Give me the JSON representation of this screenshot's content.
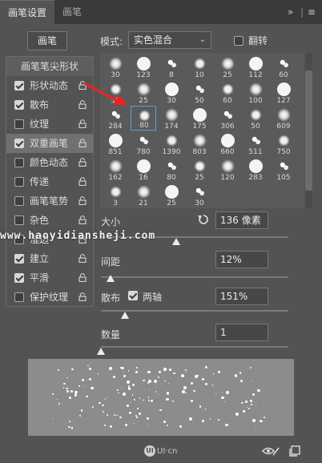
{
  "tabs": [
    {
      "label": "画笔设置",
      "active": true
    },
    {
      "label": "画笔",
      "active": false
    }
  ],
  "toolbar": {
    "expand_icon": "double-chevron-right-icon",
    "menu_icon": "menu-icon"
  },
  "brush_button_label": "画笔",
  "mode": {
    "label": "模式:",
    "value": "实色混合"
  },
  "flip": {
    "label": "翻转",
    "checked": false
  },
  "side_items": [
    {
      "label": "画笔笔尖形状",
      "head": true
    },
    {
      "label": "形状动态",
      "checked": true,
      "lock": true
    },
    {
      "label": "散布",
      "checked": true,
      "lock": true
    },
    {
      "label": "纹理",
      "checked": false,
      "lock": true
    },
    {
      "label": "双重画笔",
      "checked": true,
      "lock": true,
      "selected": true
    },
    {
      "label": "颜色动态",
      "checked": false,
      "lock": true
    },
    {
      "label": "传递",
      "checked": false,
      "lock": true
    },
    {
      "label": "画笔笔势",
      "checked": false,
      "lock": true
    },
    {
      "label": "杂色",
      "checked": false,
      "lock": true
    },
    {
      "label": "湿边",
      "checked": false,
      "lock": true
    },
    {
      "label": "建立",
      "checked": true,
      "lock": true
    },
    {
      "label": "平滑",
      "checked": true,
      "lock": true
    },
    {
      "label": "保护纹理",
      "checked": false,
      "lock": true
    }
  ],
  "brush_sizes": [
    "30",
    "123",
    "8",
    "10",
    "25",
    "112",
    "60",
    "50",
    "25",
    "30",
    "50",
    "60",
    "100",
    "127",
    "284",
    "80",
    "174",
    "175",
    "306",
    "50",
    "609",
    "851",
    "780",
    "1390",
    "803",
    "660",
    "511",
    "750",
    "162",
    "16",
    "80",
    "25",
    "120",
    "283",
    "105",
    "3",
    "21",
    "25",
    "30"
  ],
  "selected_brush_index": 15,
  "size": {
    "label": "大小",
    "value": "136 像素",
    "fraction": 0.4
  },
  "spacing": {
    "label": "间距",
    "value": "12%",
    "fraction": 0.05
  },
  "scatter": {
    "label": "散布",
    "both_axes_label": "两轴",
    "both_axes_checked": true,
    "value": "151%",
    "fraction": 0.13
  },
  "count": {
    "label": "数量",
    "value": "1",
    "fraction": 0.0
  },
  "watermark": "www.haoyidiansheji.com",
  "footer_logo": "UI·cn",
  "footer_icons": [
    "eye-brush-icon",
    "new-preset-icon"
  ]
}
